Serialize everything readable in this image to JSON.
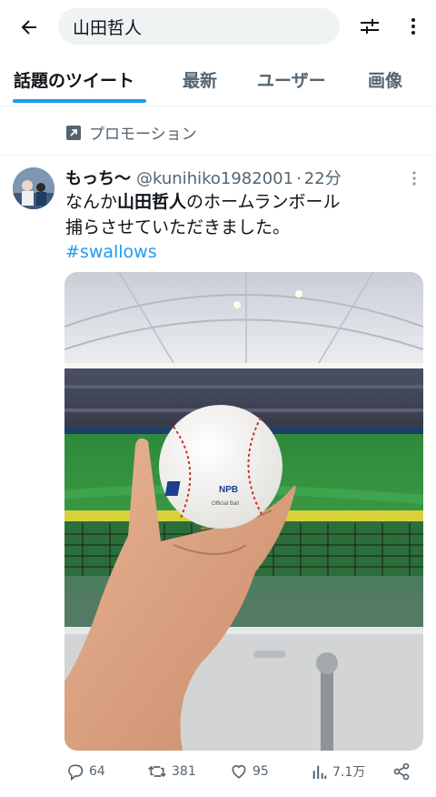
{
  "search": {
    "query": "山田哲人"
  },
  "tabs": [
    {
      "label": "話題のツイート"
    },
    {
      "label": "最新"
    },
    {
      "label": "ユーザー"
    },
    {
      "label": "画像"
    }
  ],
  "promotion": {
    "label": "プロモーション"
  },
  "tweet": {
    "name": "もっち〜",
    "handle": "@kunihiko1982001",
    "dot": "·",
    "time": "22分",
    "text_before": "なんか",
    "text_bold": "山田哲人",
    "text_after_line1": "のホームランボール",
    "text_line2": "捕らさせていただきました。",
    "hashtag": "#swallows",
    "photo": {
      "ball_logo": "NPB",
      "ball_sublabel": "Official Ball"
    },
    "stats": {
      "replies": "64",
      "retweets": "381",
      "likes": "95",
      "views": "7.1万"
    }
  },
  "colors": {
    "accent": "#1d9bf0",
    "secondary_text": "#536471",
    "primary_text": "#0f1419",
    "search_bg": "#eff3f4"
  },
  "icons": [
    "back-arrow-icon",
    "filter-icon",
    "more-vertical-icon",
    "promoted-arrow-icon",
    "reply-icon",
    "retweet-icon",
    "like-icon",
    "views-icon",
    "share-icon"
  ]
}
